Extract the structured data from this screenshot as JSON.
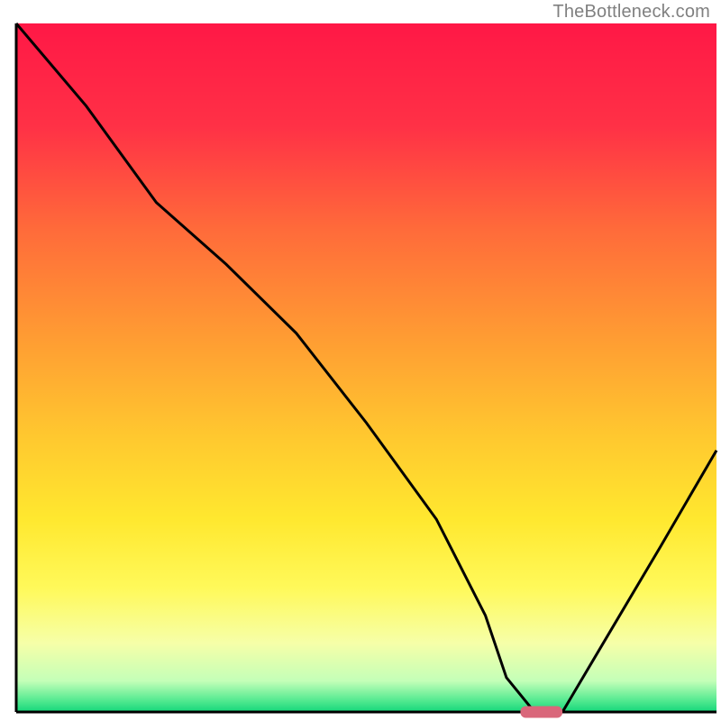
{
  "watermark": "TheBottleneck.com",
  "chart_data": {
    "type": "line",
    "title": "",
    "xlabel": "",
    "ylabel": "",
    "xlim": [
      0,
      100
    ],
    "ylim": [
      0,
      100
    ],
    "grid": false,
    "series": [
      {
        "name": "bottleneck-curve",
        "x": [
          0,
          10,
          20,
          30,
          40,
          50,
          60,
          67,
          70,
          74,
          78,
          85,
          92,
          100
        ],
        "y": [
          100,
          88,
          74,
          65,
          55,
          42,
          28,
          14,
          5,
          0,
          0,
          12,
          24,
          38
        ]
      }
    ],
    "optimal_marker": {
      "x_start": 72,
      "x_end": 78,
      "y": 0,
      "color": "#d9677a"
    },
    "gradient_stops": [
      {
        "offset": 0,
        "color": "#ff1846"
      },
      {
        "offset": 0.15,
        "color": "#ff3146"
      },
      {
        "offset": 0.3,
        "color": "#ff6b3a"
      },
      {
        "offset": 0.45,
        "color": "#ff9a33"
      },
      {
        "offset": 0.6,
        "color": "#ffc82f"
      },
      {
        "offset": 0.72,
        "color": "#ffe82f"
      },
      {
        "offset": 0.82,
        "color": "#fff95a"
      },
      {
        "offset": 0.9,
        "color": "#f6ffa8"
      },
      {
        "offset": 0.955,
        "color": "#c4ffb8"
      },
      {
        "offset": 0.985,
        "color": "#4de88e"
      },
      {
        "offset": 1.0,
        "color": "#14d67a"
      }
    ],
    "axis_color": "#000000",
    "curve_color": "#000000"
  }
}
